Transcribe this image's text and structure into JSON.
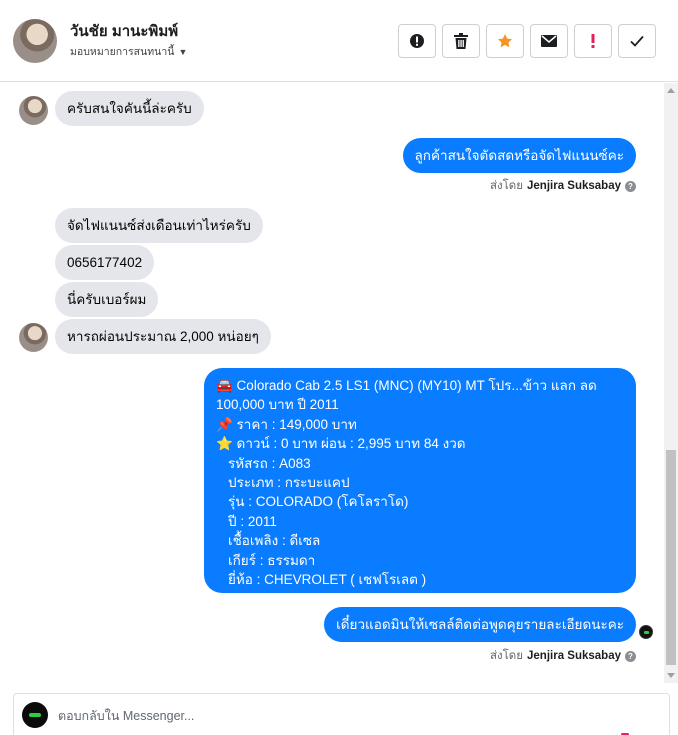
{
  "header": {
    "contact_name": "วันชัย มานะพิมพ์",
    "assign_label": "มอบหมายการสนทนานี้",
    "tools": [
      {
        "name": "report-icon",
        "color": "#1c1e21"
      },
      {
        "name": "trash-icon",
        "color": "#1c1e21"
      },
      {
        "name": "star-icon",
        "color": "#f7931e"
      },
      {
        "name": "envelope-icon",
        "color": "#1c1e21"
      },
      {
        "name": "exclamation-icon",
        "color": "#e0245e"
      },
      {
        "name": "check-icon",
        "color": "#1c1e21"
      }
    ]
  },
  "messages": [
    {
      "side": "in",
      "text": "ครับสนใจคันนี้ล่ะครับ"
    },
    {
      "side": "out",
      "text": "ลูกค้าสนใจตัดสดหรือจัดไฟแนนซ์คะ"
    },
    {
      "sent_by_prefix": "ส่งโดย",
      "sent_by_name": "Jenjira Suksabay"
    },
    {
      "side": "in",
      "text": "จัดไฟแนนซ์ส่งเดือนเท่าไหร่ครับ"
    },
    {
      "side": "in",
      "text": "0656177402"
    },
    {
      "side": "in",
      "text": "นี่ครับเบอร์ผม"
    },
    {
      "side": "in",
      "text": "หารถผ่อนประมาณ 2,000 หน่อยๆ"
    }
  ],
  "car_card": {
    "line1": "🚘 Colorado Cab 2.5 LS1 (MNC) (MY10) MT โปร...ข้าว แลก ลด",
    "line2": "100,000 บาท ปี 2011",
    "line3": "📌 ราคา : 149,000 บาท",
    "line4": "⭐ ดาวน์ : 0 บาท ผ่อน : 2,995 บาท 84 งวด",
    "line5": "รหัสรถ : A083",
    "line6": "ประเภท : กระบะแคป",
    "line7": "รุ่น : COLORADO (โคโลราโด)",
    "line8": "ปี : 2011",
    "line9": "เชื้อเพลิง : ดีเซล",
    "line10": "เกียร์ : ธรรมดา",
    "line11": "ยี่ห้อ : CHEVROLET ( เชฟโรเลต )"
  },
  "last_message": {
    "side": "out",
    "text": "เดี๋ยวแอดมินให้เซลล์ติดต่อพูดคุยรายละเอียดนะคะ"
  },
  "last_sent_by": {
    "prefix": "ส่งโดย",
    "name": "Jenjira Suksabay"
  },
  "composer": {
    "placeholder": "ตอบกลับใน Messenger..."
  },
  "colors": {
    "outgoing_bubble": "#0a7cff",
    "incoming_bubble": "#e4e6eb"
  }
}
